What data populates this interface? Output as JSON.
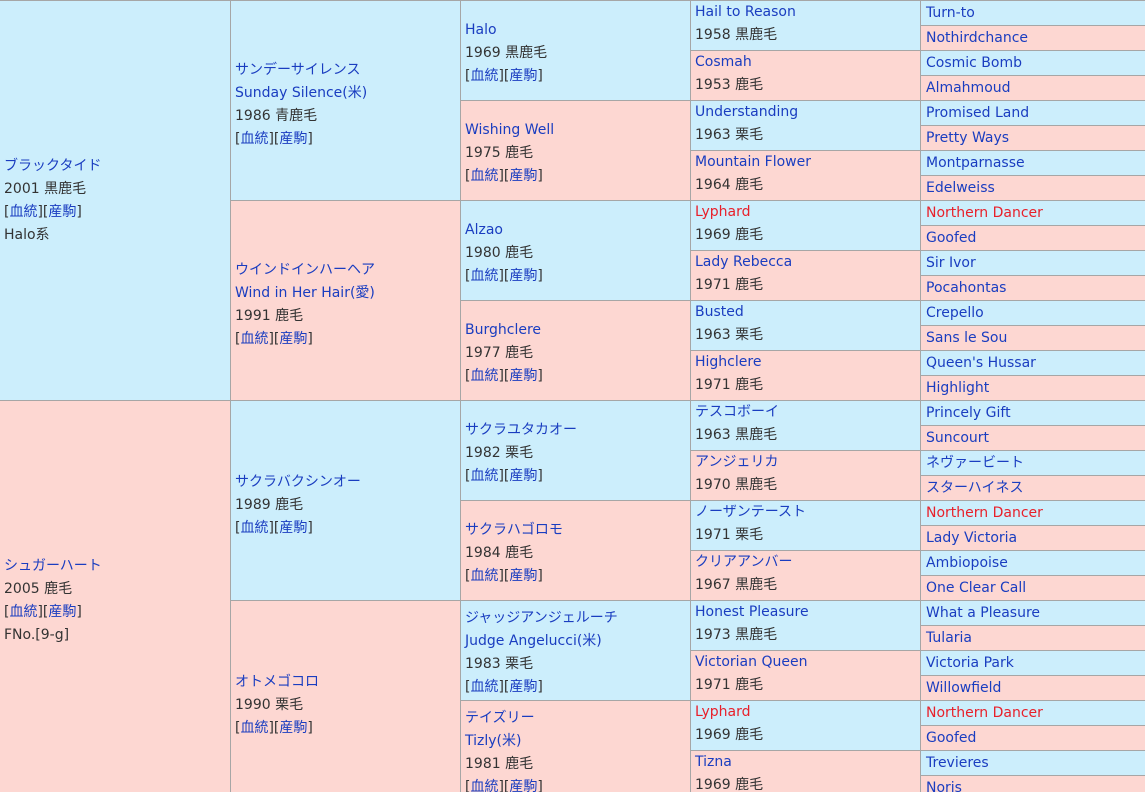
{
  "links": {
    "blood": "血統",
    "produce": "産駒"
  },
  "gen1": [
    {
      "name": "ブラックタイド",
      "info": "2001 黒鹿毛",
      "extra": "Halo系",
      "color": "blue",
      "links": true
    },
    {
      "name": "シュガーハート",
      "info": "2005 鹿毛",
      "extra": "FNo.[9-g]",
      "color": "pink",
      "links": true
    }
  ],
  "gen2": [
    {
      "name": "サンデーサイレンス",
      "sub": "Sunday Silence(米)",
      "info": "1986 青鹿毛",
      "color": "blue",
      "links": true
    },
    {
      "name": "ウインドインハーヘア",
      "sub": "Wind in Her Hair(愛)",
      "info": "1991 鹿毛",
      "color": "pink",
      "links": true
    },
    {
      "name": "サクラバクシンオー",
      "info": "1989 鹿毛",
      "color": "blue",
      "links": true
    },
    {
      "name": "オトメゴコロ",
      "info": "1990 栗毛",
      "color": "pink",
      "links": true
    }
  ],
  "gen3": [
    {
      "name": "Halo",
      "info": "1969 黒鹿毛",
      "color": "blue",
      "links": true
    },
    {
      "name": "Wishing Well",
      "info": "1975 鹿毛",
      "color": "pink",
      "links": true
    },
    {
      "name": "Alzao",
      "info": "1980 鹿毛",
      "color": "blue",
      "links": true
    },
    {
      "name": "Burghclere",
      "info": "1977 鹿毛",
      "color": "pink",
      "links": true
    },
    {
      "name": "サクラユタカオー",
      "info": "1982 栗毛",
      "color": "blue",
      "links": true
    },
    {
      "name": "サクラハゴロモ",
      "info": "1984 鹿毛",
      "color": "pink",
      "links": true
    },
    {
      "name": "ジャッジアンジェルーチ",
      "sub": "Judge Angelucci(米)",
      "info": "1983 栗毛",
      "color": "blue",
      "links": true
    },
    {
      "name": "テイズリー",
      "sub": "Tizly(米)",
      "info": "1981 鹿毛",
      "color": "pink",
      "links": true
    }
  ],
  "gen4": [
    {
      "name": "Hail to Reason",
      "info": "1958 黒鹿毛",
      "color": "blue"
    },
    {
      "name": "Cosmah",
      "info": "1953 鹿毛",
      "color": "pink"
    },
    {
      "name": "Understanding",
      "info": "1963 栗毛",
      "color": "blue"
    },
    {
      "name": "Mountain Flower",
      "info": "1964 鹿毛",
      "color": "pink"
    },
    {
      "name": "Lyphard",
      "info": "1969 鹿毛",
      "color": "blue",
      "red": true
    },
    {
      "name": "Lady Rebecca",
      "info": "1971 鹿毛",
      "color": "pink"
    },
    {
      "name": "Busted",
      "info": "1963 栗毛",
      "color": "blue"
    },
    {
      "name": "Highclere",
      "info": "1971 鹿毛",
      "color": "pink"
    },
    {
      "name": "テスコボーイ",
      "info": "1963 黒鹿毛",
      "color": "blue"
    },
    {
      "name": "アンジェリカ",
      "info": "1970 黒鹿毛",
      "color": "pink"
    },
    {
      "name": "ノーザンテースト",
      "info": "1971 栗毛",
      "color": "blue"
    },
    {
      "name": "クリアアンバー",
      "info": "1967 黒鹿毛",
      "color": "pink"
    },
    {
      "name": "Honest Pleasure",
      "info": "1973 黒鹿毛",
      "color": "blue"
    },
    {
      "name": "Victorian Queen",
      "info": "1971 鹿毛",
      "color": "pink"
    },
    {
      "name": "Lyphard",
      "info": "1969 鹿毛",
      "color": "blue",
      "red": true
    },
    {
      "name": "Tizna",
      "info": "1969 鹿毛",
      "color": "pink"
    }
  ],
  "gen5": [
    {
      "name": "Turn-to",
      "color": "blue"
    },
    {
      "name": "Nothirdchance",
      "color": "pink"
    },
    {
      "name": "Cosmic Bomb",
      "color": "blue"
    },
    {
      "name": "Almahmoud",
      "color": "pink"
    },
    {
      "name": "Promised Land",
      "color": "blue"
    },
    {
      "name": "Pretty Ways",
      "color": "pink"
    },
    {
      "name": "Montparnasse",
      "color": "blue"
    },
    {
      "name": "Edelweiss",
      "color": "pink"
    },
    {
      "name": "Northern Dancer",
      "color": "blue",
      "red": true
    },
    {
      "name": "Goofed",
      "color": "pink"
    },
    {
      "name": "Sir Ivor",
      "color": "blue"
    },
    {
      "name": "Pocahontas",
      "color": "pink"
    },
    {
      "name": "Crepello",
      "color": "blue"
    },
    {
      "name": "Sans le Sou",
      "color": "pink"
    },
    {
      "name": "Queen's Hussar",
      "color": "blue"
    },
    {
      "name": "Highlight",
      "color": "pink"
    },
    {
      "name": "Princely Gift",
      "color": "blue"
    },
    {
      "name": "Suncourt",
      "color": "pink"
    },
    {
      "name": "ネヴァービート",
      "color": "blue"
    },
    {
      "name": "スターハイネス",
      "color": "pink"
    },
    {
      "name": "Northern Dancer",
      "color": "blue",
      "red": true
    },
    {
      "name": "Lady Victoria",
      "color": "pink"
    },
    {
      "name": "Ambiopoise",
      "color": "blue"
    },
    {
      "name": "One Clear Call",
      "color": "pink"
    },
    {
      "name": "What a Pleasure",
      "color": "blue"
    },
    {
      "name": "Tularia",
      "color": "pink"
    },
    {
      "name": "Victoria Park",
      "color": "blue"
    },
    {
      "name": "Willowfield",
      "color": "pink"
    },
    {
      "name": "Northern Dancer",
      "color": "blue",
      "red": true
    },
    {
      "name": "Goofed",
      "color": "pink"
    },
    {
      "name": "Trevieres",
      "color": "blue"
    },
    {
      "name": "Noris",
      "color": "pink"
    }
  ]
}
